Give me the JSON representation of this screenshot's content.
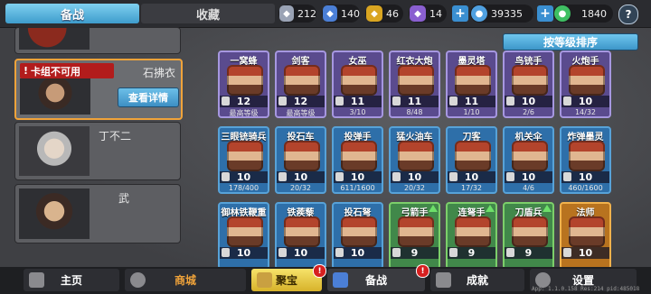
{
  "tabs": {
    "active": "备战",
    "inactive": "收藏"
  },
  "resources": [
    {
      "icon": "silver-shield-icon",
      "value": "212",
      "color": "#9aa3b5"
    },
    {
      "icon": "blue-shield-icon",
      "value": "140",
      "color": "#4b7fd6"
    },
    {
      "icon": "gold-shield-icon",
      "value": "46",
      "color": "#d9a521"
    },
    {
      "icon": "purple-shield-icon",
      "value": "14",
      "color": "#8a5fd0"
    },
    {
      "icon": "gem-icon",
      "value": "39335",
      "color": "#4fa0e0"
    },
    {
      "icon": "jade-icon",
      "value": "1840",
      "color": "#3fbf63"
    }
  ],
  "help_label": "?",
  "sort_label": "按等级排序",
  "heroes": [
    {
      "name": "石拂衣",
      "warning": "卡组不可用",
      "detail_label": "查看详情"
    },
    {
      "name": "丁不二"
    },
    {
      "name": "武"
    }
  ],
  "units": [
    {
      "name": "一窝蜂",
      "level": "12",
      "sub": "最高等级",
      "tier": "purple"
    },
    {
      "name": "剑客",
      "level": "12",
      "sub": "最高等级",
      "tier": "purple"
    },
    {
      "name": "女巫",
      "level": "11",
      "sub": "3/10",
      "tier": "purple"
    },
    {
      "name": "红衣大炮",
      "level": "11",
      "sub": "8/48",
      "tier": "purple"
    },
    {
      "name": "墨灵塔",
      "level": "11",
      "sub": "1/10",
      "tier": "purple"
    },
    {
      "name": "鸟铳手",
      "level": "10",
      "sub": "2/6",
      "tier": "purple"
    },
    {
      "name": "火炮手",
      "level": "10",
      "sub": "14/32",
      "tier": "purple"
    },
    {
      "name": "三眼铳骑兵",
      "level": "10",
      "sub": "178/400",
      "tier": "blue"
    },
    {
      "name": "投石车",
      "level": "10",
      "sub": "20/32",
      "tier": "blue"
    },
    {
      "name": "投弹手",
      "level": "10",
      "sub": "611/1600",
      "tier": "blue"
    },
    {
      "name": "猛火油车",
      "level": "10",
      "sub": "20/32",
      "tier": "blue"
    },
    {
      "name": "刀客",
      "level": "10",
      "sub": "17/32",
      "tier": "blue"
    },
    {
      "name": "机关伞",
      "level": "10",
      "sub": "4/6",
      "tier": "blue"
    },
    {
      "name": "炸弹墨灵",
      "level": "10",
      "sub": "460/1600",
      "tier": "blue"
    },
    {
      "name": "御林铁鞭重骑兵",
      "level": "10",
      "sub": "",
      "tier": "blue"
    },
    {
      "name": "铁蒺藜",
      "level": "10",
      "sub": "",
      "tier": "blue"
    },
    {
      "name": "投石弩",
      "level": "10",
      "sub": "",
      "tier": "blue"
    },
    {
      "name": "弓箭手",
      "level": "9",
      "sub": "",
      "tier": "green",
      "upgrade": true
    },
    {
      "name": "连弩手",
      "level": "9",
      "sub": "",
      "tier": "green",
      "upgrade": true
    },
    {
      "name": "刀盾兵",
      "level": "9",
      "sub": "",
      "tier": "green",
      "upgrade": true
    },
    {
      "name": "法师",
      "level": "10",
      "sub": "",
      "tier": "orange"
    }
  ],
  "nav": [
    {
      "label": "主页",
      "icon": "home-icon"
    },
    {
      "label": "商城",
      "icon": "shop-icon",
      "color": "#f0a33a"
    },
    {
      "label": "聚宝",
      "icon": "treasure-icon",
      "badge": "!"
    },
    {
      "label": "备战",
      "icon": "deck-icon",
      "badge": "!"
    },
    {
      "label": "成就",
      "icon": "achievement-icon"
    },
    {
      "label": "设置",
      "icon": "gear-icon"
    }
  ],
  "version": "App: 1.1.0.158 Res:214 pid:485018"
}
